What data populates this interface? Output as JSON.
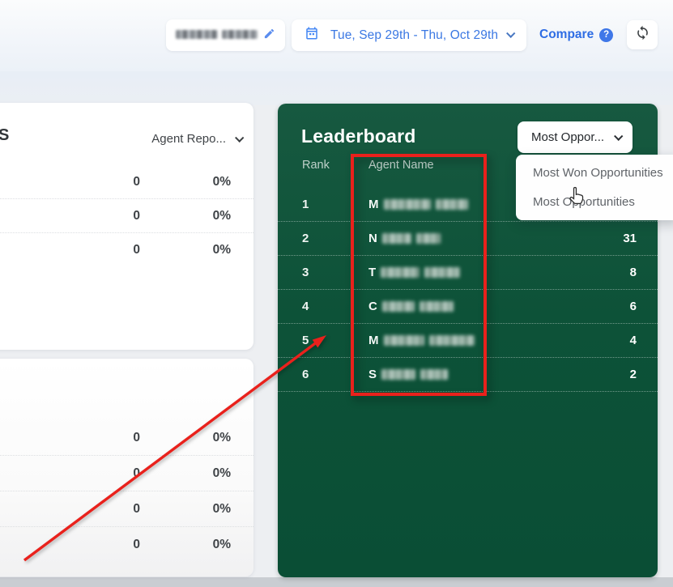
{
  "topbar": {
    "user_selector": {
      "redacted": true,
      "blur_widths": [
        52,
        44
      ]
    },
    "date_range": "Tue, Sep 29th - Thu, Oct 29th",
    "compare_label": "Compare",
    "help_glyph": "?"
  },
  "left_top_card": {
    "title_fragment": "S",
    "dropdown_label": "Agent Repo...",
    "rows": [
      {
        "count": "0",
        "percent": "0%"
      },
      {
        "count": "0",
        "percent": "0%"
      },
      {
        "count": "0",
        "percent": "0%"
      }
    ]
  },
  "left_bottom_card": {
    "rows": [
      {
        "count": "0",
        "percent": "0%"
      },
      {
        "count": "0",
        "percent": "0%"
      },
      {
        "count": "0",
        "percent": "0%"
      },
      {
        "count": "0",
        "percent": "0%"
      }
    ]
  },
  "leaderboard": {
    "title": "Leaderboard",
    "dropdown_label": "Most Oppor...",
    "columns": {
      "rank": "Rank",
      "agent": "Agent Name"
    },
    "rows": [
      {
        "rank": "1",
        "initial": "M",
        "blur": [
          58,
          40
        ],
        "value": ""
      },
      {
        "rank": "2",
        "initial": "N",
        "blur": [
          36,
          30
        ],
        "value": "31"
      },
      {
        "rank": "3",
        "initial": "T",
        "blur": [
          48,
          44
        ],
        "value": "8"
      },
      {
        "rank": "4",
        "initial": "C",
        "blur": [
          40,
          42
        ],
        "value": "6"
      },
      {
        "rank": "5",
        "initial": "M",
        "blur": [
          50,
          56
        ],
        "value": "4"
      },
      {
        "rank": "6",
        "initial": "S",
        "blur": [
          42,
          34
        ],
        "value": "2"
      }
    ],
    "menu_items": [
      "Most Won Opportunities",
      "Most Opportunities"
    ]
  },
  "colors": {
    "leaderboard_green": "#0d5238",
    "annotation_red": "#e9211c",
    "link_blue": "#2e6de4",
    "date_blue": "#3b78e3"
  }
}
